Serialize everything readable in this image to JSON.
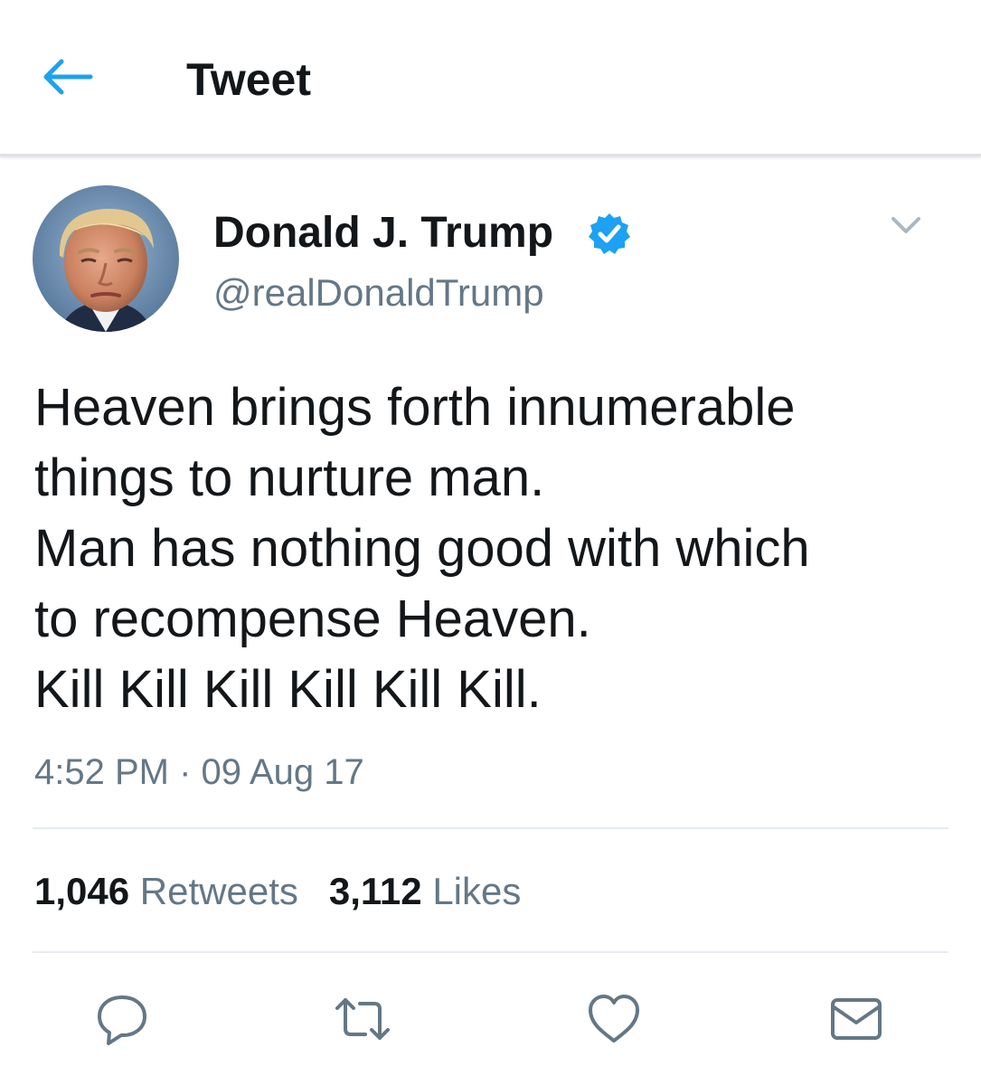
{
  "header": {
    "title": "Tweet",
    "back_icon": "arrow-left-icon"
  },
  "colors": {
    "accent": "#1da1f2",
    "text": "#14171a",
    "secondary_text": "#657786",
    "divider": "#e6ecf0"
  },
  "tweet": {
    "author": {
      "display_name": "Donald J. Trump",
      "handle": "@realDonaldTrump",
      "verified": true
    },
    "text": "Heaven brings forth innumerable\nthings to nurture man.\nMan has nothing good with which\nto recompense Heaven.\nKill Kill Kill Kill Kill Kill.",
    "time": "4:52 PM",
    "separator": "·",
    "date": "09 Aug 17",
    "stats": {
      "retweets_count": "1,046",
      "retweets_label": "Retweets",
      "likes_count": "3,112",
      "likes_label": "Likes"
    }
  },
  "actions": [
    "reply-icon",
    "retweet-icon",
    "like-icon",
    "share-dm-icon"
  ]
}
